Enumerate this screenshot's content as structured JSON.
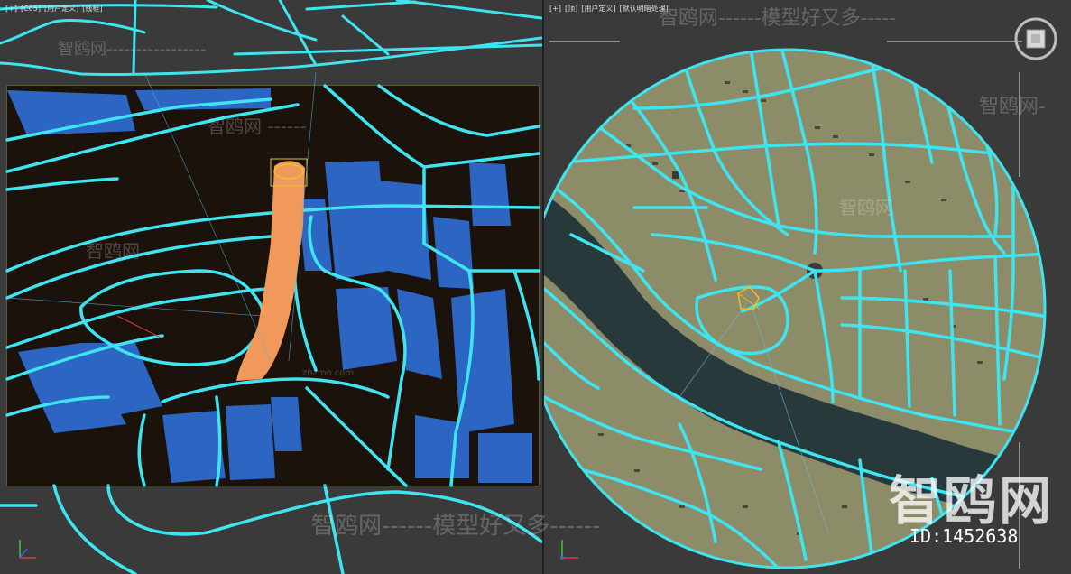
{
  "left_viewport": {
    "labels": [
      "[+]",
      "[C05]",
      "[用户定义]",
      "[线框]"
    ]
  },
  "right_viewport": {
    "labels": [
      "[+]",
      "[顶]",
      "[用户定义]",
      "[默认明暗处理]"
    ]
  },
  "watermarks": {
    "top_center": "智鸥网------模型好又多-----",
    "top_left": "智鸥网-----------------",
    "left_mid": "智鸥网 ------",
    "left_small_url": "znzmo.com",
    "left_lower": "智鸥网",
    "right_mid": "智鸥网-",
    "right_center": "智鸥网",
    "bottom_center": "智鸥网------模型好又多------",
    "big_logo": "智鸥网",
    "id_text": "ID:1452638"
  },
  "colors": {
    "road_cyan": "#3ee4ef",
    "building_blue": "#2f6fd6",
    "tower_orange": "#f0995a",
    "land_olive": "#8d8c68",
    "river_dark": "#28393c",
    "viewport_bg": "#3a3a3a"
  },
  "icons": {
    "viewcube": "viewcube-icon",
    "axis": "axis-gizmo-icon",
    "selected_object": "selection-gizmo-icon"
  }
}
